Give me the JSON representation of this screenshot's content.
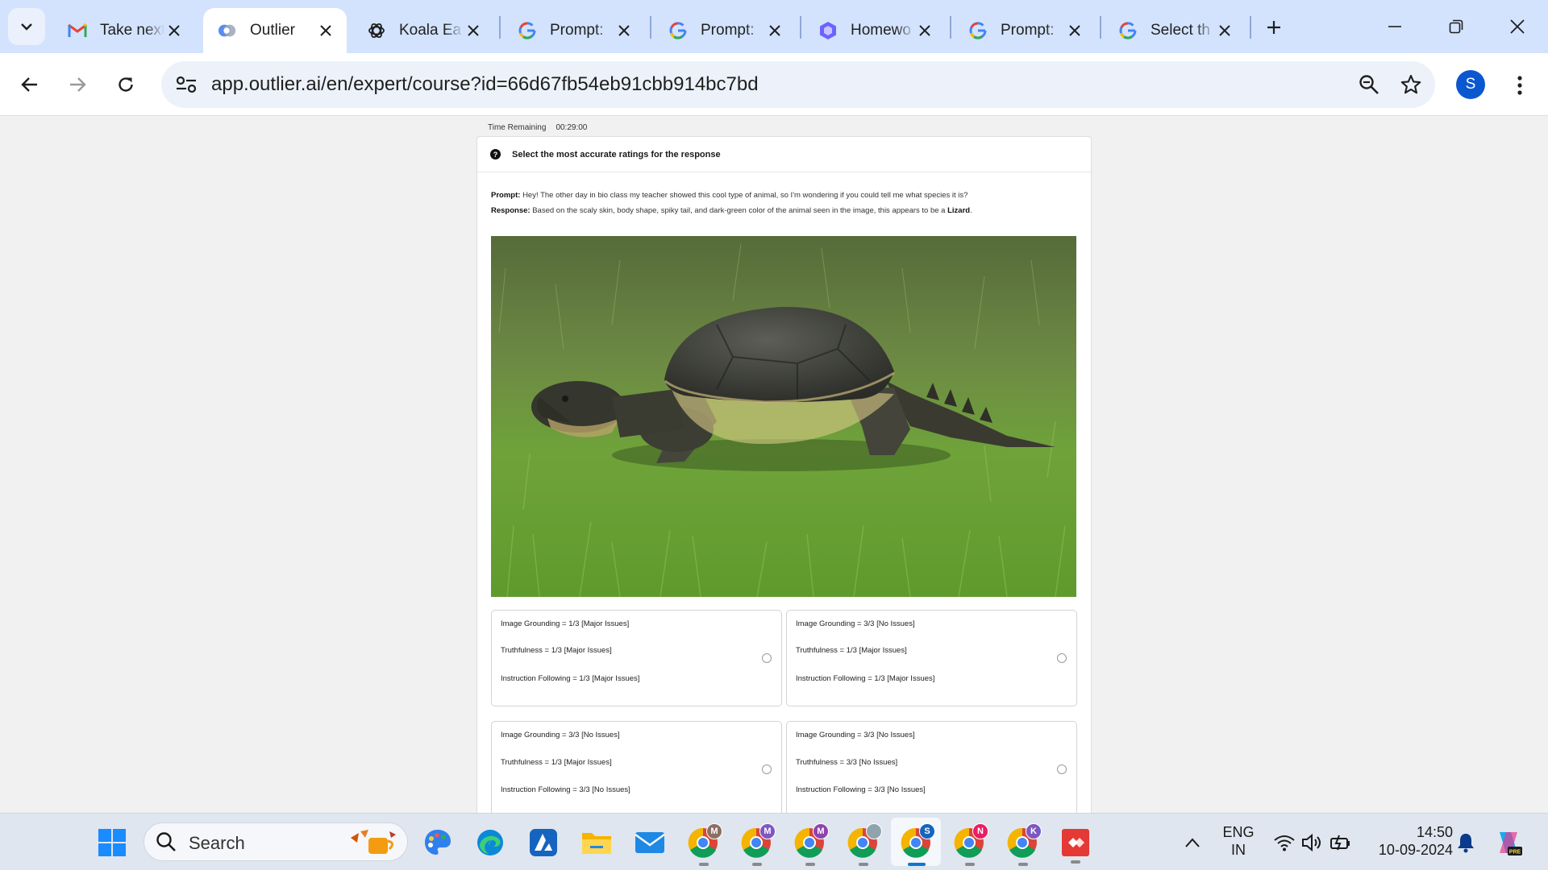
{
  "browser": {
    "tabs": [
      {
        "title": "Take next",
        "icon": "gmail-icon"
      },
      {
        "title": "Outlier",
        "icon": "outlier-icon",
        "active": true
      },
      {
        "title": "Koala Ea",
        "icon": "openai-icon"
      },
      {
        "title": "Prompt:",
        "icon": "google-icon"
      },
      {
        "title": "Prompt:",
        "icon": "google-icon"
      },
      {
        "title": "Homewo",
        "icon": "homework-icon"
      },
      {
        "title": "Prompt:",
        "icon": "google-icon"
      },
      {
        "title": "Select th",
        "icon": "google-icon"
      }
    ],
    "url": "app.outlier.ai/en/expert/course?id=66d67fb54eb91cbb914bc7bd",
    "profile_initial": "S"
  },
  "page": {
    "timer_label": "Time Remaining",
    "timer_value": "00:29:00",
    "question": "Select the most accurate ratings for the response",
    "prompt_label": "Prompt:",
    "prompt_text": "Hey! The other day in bio class my teacher showed this cool type of animal, so I'm wondering if you could tell me what species it is?",
    "response_label": "Response:",
    "response_text": "Based on the scaly skin, body shape, spiky tail, and dark-green color of the animal seen in the image, this appears to be a",
    "response_answer": "Lizard",
    "response_end": ".",
    "options": [
      {
        "image_grounding": "Image Grounding = 1/3 [Major Issues]",
        "truthfulness": "Truthfulness = 1/3 [Major Issues]",
        "instruction_following": "Instruction Following = 1/3 [Major Issues]"
      },
      {
        "image_grounding": "Image Grounding = 3/3 [No Issues]",
        "truthfulness": "Truthfulness = 1/3 [Major Issues]",
        "instruction_following": "Instruction Following = 1/3 [Major Issues]"
      },
      {
        "image_grounding": "Image Grounding = 3/3 [No Issues]",
        "truthfulness": "Truthfulness = 1/3 [Major Issues]",
        "instruction_following": "Instruction Following = 3/3 [No Issues]"
      },
      {
        "image_grounding": "Image Grounding = 3/3 [No Issues]",
        "truthfulness": "Truthfulness = 3/3 [No Issues]",
        "instruction_following": "Instruction Following = 3/3 [No Issues]"
      }
    ]
  },
  "taskbar": {
    "search_label": "Search",
    "chrome_profiles": [
      {
        "letter": "M",
        "color": "#8d6e63"
      },
      {
        "letter": "M",
        "color": "#7e57c2"
      },
      {
        "letter": "M",
        "color": "#8e44ad"
      },
      {
        "letter": "",
        "color": "#90a4ae"
      },
      {
        "letter": "S",
        "color": "#1565c0"
      },
      {
        "letter": "N",
        "color": "#e91e63"
      },
      {
        "letter": "K",
        "color": "#7e57c2"
      }
    ],
    "lang_top": "ENG",
    "lang_bottom": "IN",
    "time": "14:50",
    "date": "10-09-2024"
  }
}
